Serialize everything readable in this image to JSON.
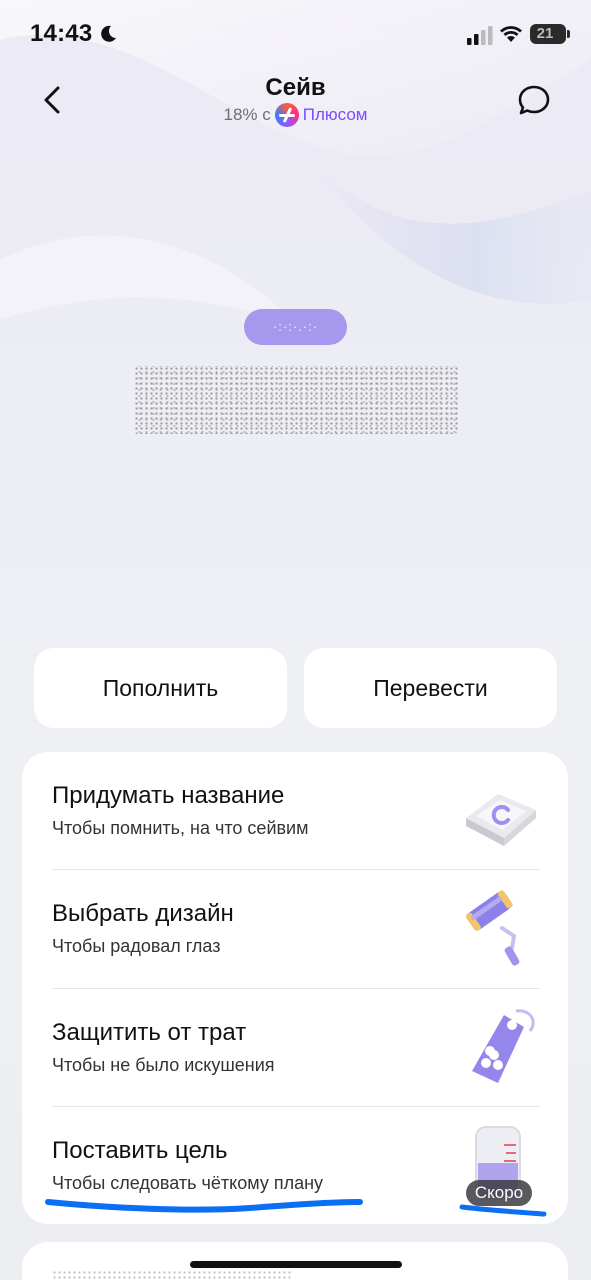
{
  "status_bar": {
    "time": "14:43",
    "battery": "21",
    "icons": [
      "moon-icon",
      "signal-icon",
      "wifi-icon",
      "battery-icon"
    ]
  },
  "header": {
    "title": "Сейв",
    "subtitle_rate": "18% с",
    "subtitle_brand": "Плюсом",
    "icons": [
      "back-arrow-icon",
      "chat-bubble-icon",
      "plus-logo-icon"
    ]
  },
  "balance": {
    "label_pill": "·:·:·.·:·",
    "amount": ""
  },
  "actions": {
    "topup_label": "Пополнить",
    "transfer_label": "Перевести"
  },
  "setup_card": {
    "items": [
      {
        "title": "Придумать название",
        "subtitle": "Чтобы помнить, на что сейвим",
        "icon": "keycap-icon"
      },
      {
        "title": "Выбрать дизайн",
        "subtitle": "Чтобы радовал глаз",
        "icon": "paint-roller-icon"
      },
      {
        "title": "Защитить от трат",
        "subtitle": "Чтобы не было искушения",
        "icon": "tag-lock-icon"
      },
      {
        "title": "Поставить цель",
        "subtitle": "Чтобы следовать чёткому плану",
        "icon": "measuring-cup-icon",
        "badge": "Скоро"
      }
    ]
  },
  "colors": {
    "accent": "#7b4bff",
    "pill": "#a698ec",
    "underline": "#0a6ff2",
    "card": "#ffffff"
  }
}
